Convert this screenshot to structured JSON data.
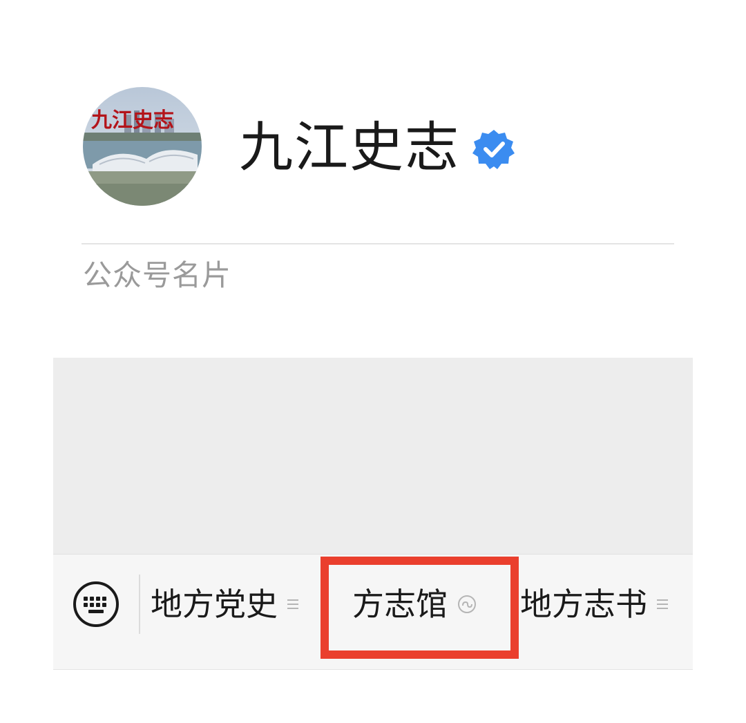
{
  "profile": {
    "name": "九江史志",
    "card_label": "公众号名片",
    "avatar_text": "九江史志"
  },
  "menu": {
    "items": [
      {
        "label": "地方党史",
        "icon": "menu-lines-icon"
      },
      {
        "label": "方志馆",
        "icon": "mini-program-icon"
      },
      {
        "label": "地方志书",
        "icon": "menu-lines-icon"
      }
    ],
    "highlighted_item": "方志馆"
  },
  "colors": {
    "verified_badge": "#3b8cf0",
    "highlight_box": "#ea3f2d",
    "chat_background": "#ededed",
    "menu_background": "#f6f6f6"
  }
}
